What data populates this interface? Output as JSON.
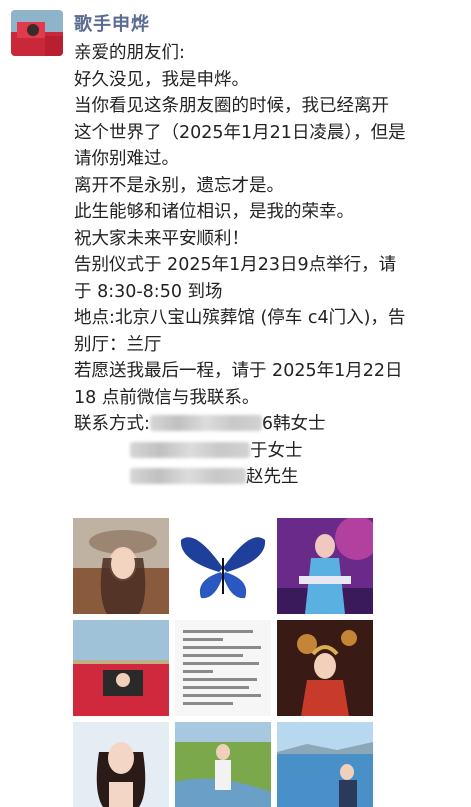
{
  "author": {
    "name": "歌手申烨"
  },
  "post": {
    "lines": [
      "亲爱的朋友们:",
      "好久没见，我是申烨。",
      "当你看见这条朋友圈的时候，我已经离开",
      "这个世界了（2025年1月21日凌晨），但是",
      "请你别难过。",
      "离开不是永别，遗忘才是。",
      "此生能够和诸位相识，是我的荣幸。",
      "祝大家未来平安顺利！",
      "告别仪式于 2025年1月23日9点举行，请",
      "于 8:30-8:50 到场",
      "地点:北京八宝山殡葬馆 (停车 c4门入)，告",
      "别厅：兰厅",
      "若愿送我最后一程，请于 2025年1月22日",
      "18 点前微信与我联系。"
    ],
    "contact_label": "联系方式:",
    "contacts": [
      {
        "suffix": "6韩女士"
      },
      {
        "suffix": "于女士"
      },
      {
        "suffix": "赵先生"
      }
    ]
  },
  "images": [
    {
      "icon": "woman-in-hat-photo"
    },
    {
      "icon": "blue-butterfly-image"
    },
    {
      "icon": "stage-performance-photo"
    },
    {
      "icon": "red-car-photo"
    },
    {
      "icon": "letter-screenshot"
    },
    {
      "icon": "costume-portrait-photo"
    },
    {
      "icon": "portrait-photo"
    },
    {
      "icon": "riverside-photo"
    },
    {
      "icon": "lakeside-photo"
    }
  ],
  "colors": {
    "name": "#5b6b91"
  }
}
